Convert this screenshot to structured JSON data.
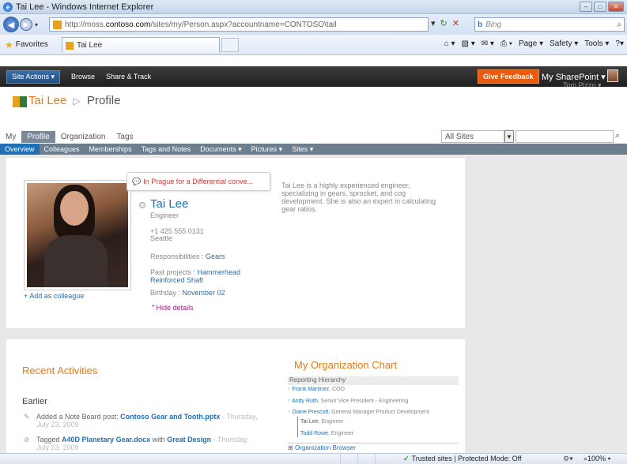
{
  "browser": {
    "window_title": "Tai Lee - Windows Internet Explorer",
    "url_prefix": "http://moss.",
    "url_domain": "contoso.com",
    "url_suffix": "/sites/my/Person.aspx?accountname=CONTOSO\\tail",
    "search_placeholder": "Bing",
    "favorites_label": "Favorites",
    "tab_title": "Tai Lee",
    "commands": [
      "Page ▾",
      "Safety ▾",
      "Tools ▾"
    ]
  },
  "ribbon": {
    "site_actions": "Site Actions ▾",
    "browse": "Browse",
    "share_track": "Share & Track",
    "feedback": "Give Feedback",
    "my_sharepoint": "My SharePoint ▾",
    "user_name": "Tom Pizzo ▾"
  },
  "header": {
    "person_name": "Tai Lee",
    "separator": "▷",
    "page_title": "Profile"
  },
  "tabs": [
    {
      "label": "My"
    },
    {
      "label": "Profile"
    },
    {
      "label": "Organization"
    },
    {
      "label": "Tags"
    }
  ],
  "search": {
    "scope": "All Sites"
  },
  "subnav": [
    "Overview",
    "Colleagues",
    "Memberships",
    "Tags and Notes",
    "Documents ▾",
    "Pictures ▾",
    "Sites ▾"
  ],
  "profile": {
    "status": "In Prague for a Differential conve...",
    "name": "Tai Lee",
    "title": "Engineer",
    "phone": "+1 425 555 0131",
    "city": "Seattle",
    "responsibilities_label": "Responsibilities : ",
    "responsibilities_value": "Gears",
    "past_label": "Past projects : ",
    "past_value": "Hammerhead Reinforced Shaft",
    "birthday_label": "Birthday : ",
    "birthday_value": "November 02",
    "hide_details": "Hide details",
    "add_colleague": "+ Add as colleague",
    "about": "Tai Lee is a highly experienced engineer, specializing in gears, sprocket, and cog development. She is also an expert in calculating gear ratios."
  },
  "activities": {
    "title": "Recent Activities",
    "section": "Earlier",
    "items": [
      {
        "prefix": "Added a Note Board post: ",
        "object": "Contoso Gear and Tooth.pptx",
        "middle": "",
        "object2": "",
        "date": " - Thursday, July 23, 2009"
      },
      {
        "prefix": "Tagged ",
        "object": "A40D Planetary Gear.docx",
        "middle": " with ",
        "object2": "Great Design",
        "date": " - Thursday, July 23, 2009"
      }
    ]
  },
  "org_chart": {
    "title": "My Organization Chart",
    "hierarchy_label": "Reporting Hierarchy",
    "people": [
      {
        "name": "Frank Martinez",
        "role": ", COO"
      },
      {
        "name": "Andy Ruth",
        "role": ", Senior Vice President - Engineering"
      },
      {
        "name": "Diane Prescott",
        "role": ", General Manager Product Development"
      },
      {
        "name": "Tai Lee",
        "role": ", Engineer"
      },
      {
        "name": "Todd Rowe",
        "role": ", Engineer"
      }
    ],
    "browser_link": "Organization Browser"
  },
  "statusbar": {
    "zone": "Trusted sites | Protected Mode: Off",
    "zoom": "100%"
  }
}
